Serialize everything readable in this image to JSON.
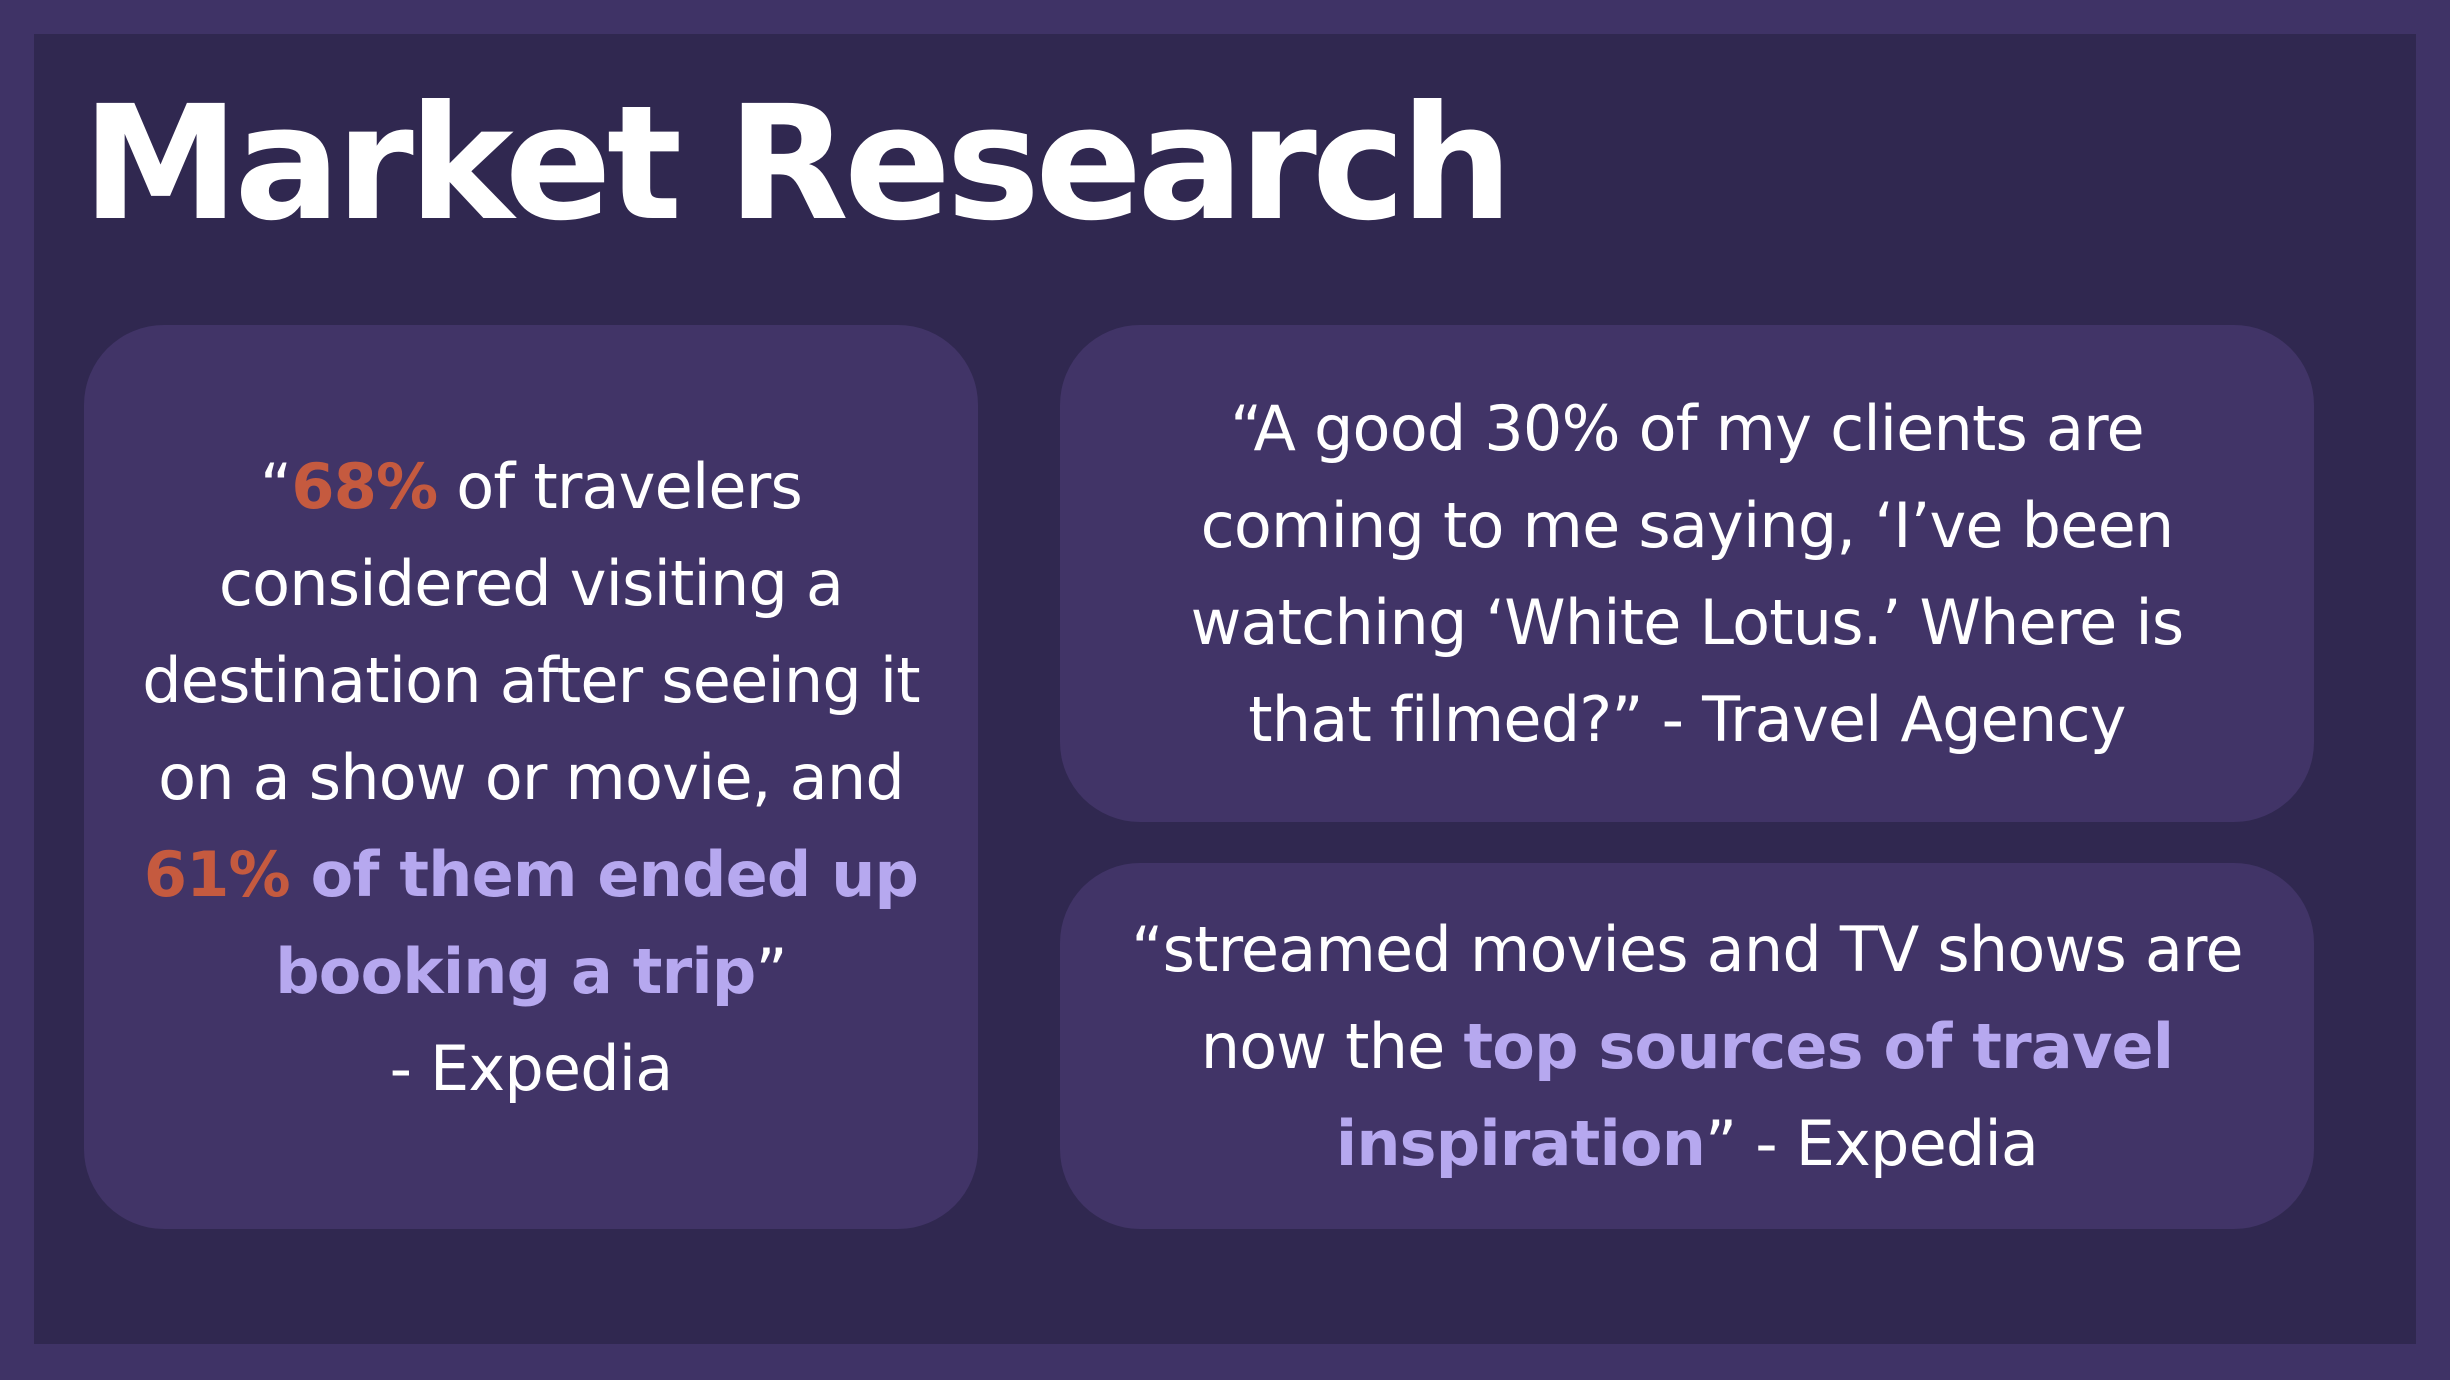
{
  "slide": {
    "title": "Market Research",
    "colors": {
      "frame": "#3f3366",
      "background": "#302850",
      "card": "#413467",
      "stat_orange": "#c55a3f",
      "emphasis_lavender": "#b6a8ef",
      "text": "#ffffff"
    },
    "cards": [
      {
        "segments": {
          "open_quote": "“",
          "stat_1": "68%",
          "text_1": " of travelers considered visiting a destination after seeing it on a show or movie, and ",
          "stat_2": "61%",
          "emphasis": " of them ended up booking a trip",
          "close_quote": "”",
          "attribution": "- Expedia"
        }
      },
      {
        "text": "“A good 30% of my clients are coming to me saying, ‘I’ve been watching ‘White Lotus.’ Where is that filmed?” - Travel Agency"
      },
      {
        "segments": {
          "text_1": "“streamed movies and TV shows are now the ",
          "emphasis": "top sources of travel inspiration",
          "text_2": "” - Expedia"
        }
      }
    ]
  }
}
